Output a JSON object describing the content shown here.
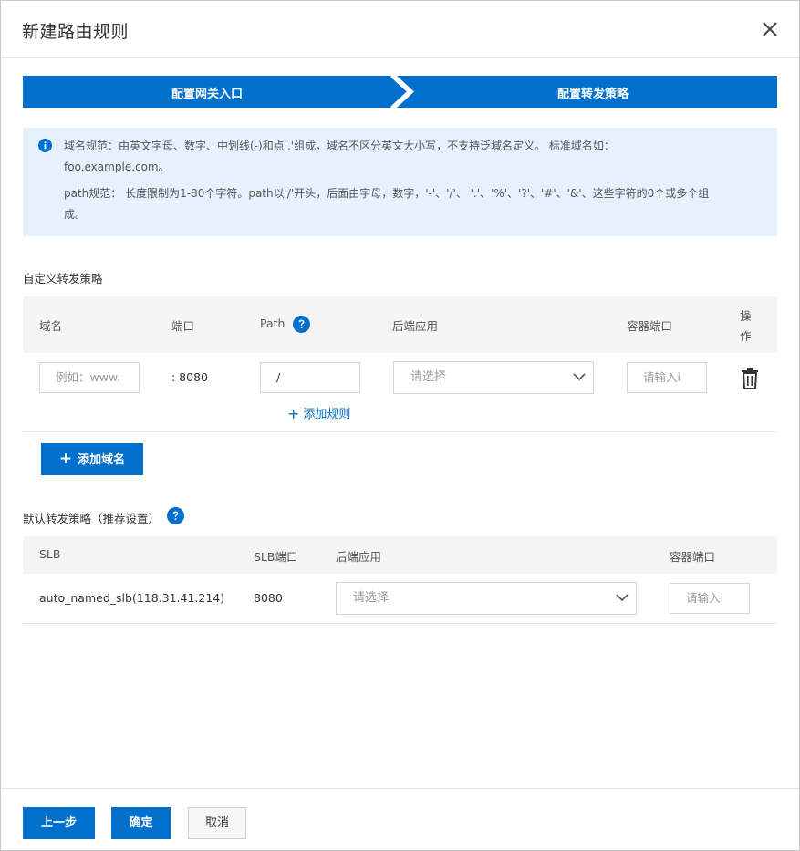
{
  "dialog": {
    "title": "新建路由规则"
  },
  "steps": [
    {
      "label": "配置网关入口"
    },
    {
      "label": "配置转发策略"
    }
  ],
  "notice": {
    "line1": "域名规范：由英文字母、数字、中划线(-)和点'.'组成，域名不区分英文大小写，不支持泛域名定义。 标准域名如：",
    "line2": "foo.example.com。",
    "line3": "path规范： 长度限制为1-80个字符。path以'/'开头，后面由字母，数字，'-'、'/'、 '.'、'%'、'?'、'#'、'&'、这些字符的0个或多个组",
    "line4": "成。"
  },
  "custom": {
    "title": "自定义转发策略",
    "headers": {
      "domain": "域名",
      "port": "端口",
      "path": "Path",
      "backend": "后端应用",
      "container_port": "容器端口",
      "action1": "操",
      "action2": "作"
    },
    "row": {
      "domain_placeholder": "例如：www.",
      "port": ": 8080",
      "path_value": "/",
      "backend_placeholder": "请选择",
      "container_port_placeholder": "请输入i"
    },
    "add_rule": "添加规则",
    "add_domain": "添加域名"
  },
  "default": {
    "title": "默认转发策略（推荐设置）",
    "headers": {
      "slb": "SLB",
      "slb_port": "SLB端口",
      "backend": "后端应用",
      "container_port": "容器端口"
    },
    "row": {
      "slb": "auto_named_slb(118.31.41.214)",
      "slb_port": "8080",
      "backend_placeholder": "请选择",
      "container_port_placeholder": "请输入i"
    }
  },
  "footer": {
    "prev": "上一步",
    "confirm": "确定",
    "cancel": "取消"
  },
  "icons": {
    "close": "close-icon",
    "info": "info-icon",
    "help": "question-icon",
    "trash": "trash-icon",
    "chevron": "chevron-down-icon",
    "plus": "plus-icon"
  },
  "colors": {
    "primary": "#0070cc",
    "notice_bg": "#e5f2fd"
  }
}
